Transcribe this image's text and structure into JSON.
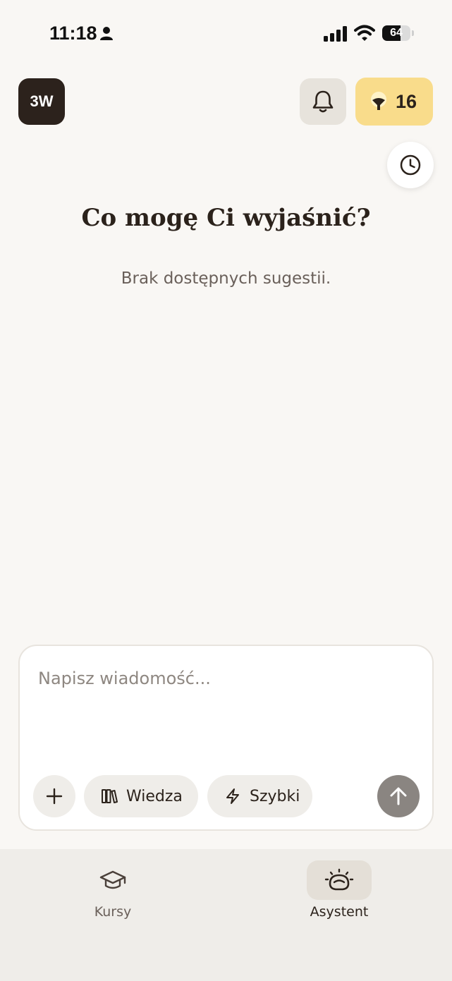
{
  "status_bar": {
    "time": "11:18",
    "battery_level": "64",
    "battery_percent": 64
  },
  "header": {
    "logo_text": "3W",
    "points_count": "16",
    "points_color": "#f9dc8b"
  },
  "main": {
    "heading": "Co mogę Ci wyjaśnić?",
    "subtitle": "Brak dostępnych sugestii."
  },
  "composer": {
    "placeholder": "Napisz wiadomość...",
    "value": "",
    "knowledge_label": "Wiedza",
    "quick_label": "Szybki"
  },
  "bottom_nav": {
    "items": [
      {
        "label": "Kursy",
        "icon": "graduation-cap-icon",
        "active": false
      },
      {
        "label": "Asystent",
        "icon": "assistant-bulb-icon",
        "active": true
      }
    ]
  },
  "colors": {
    "background": "#f9f7f4",
    "dark": "#2c221c",
    "accent_yellow": "#f9dc8b",
    "nav_background": "#efede9"
  }
}
